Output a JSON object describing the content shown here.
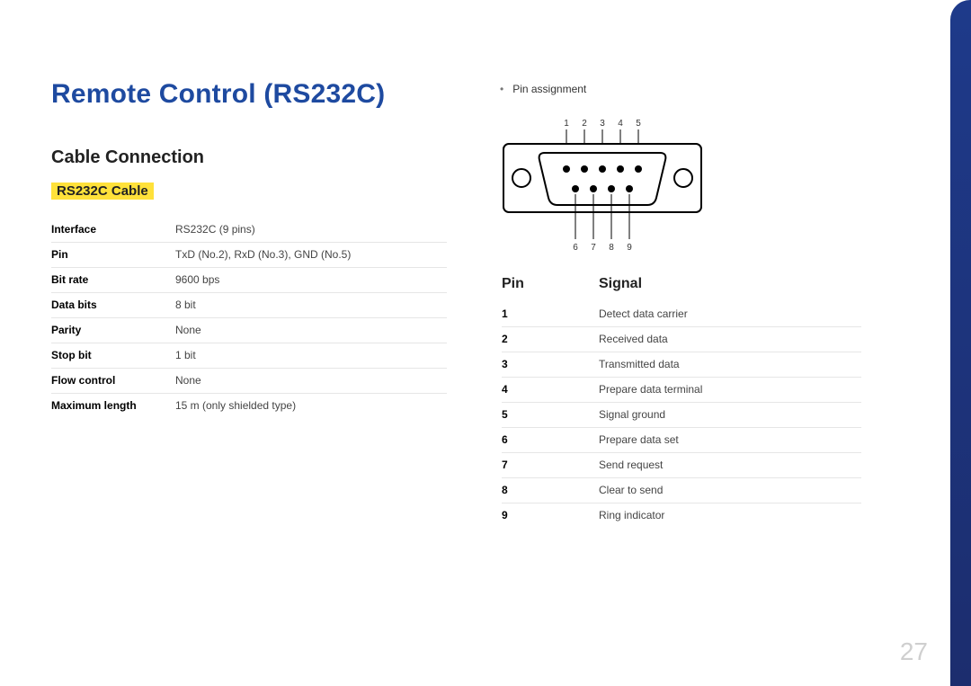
{
  "title": "Remote Control (RS232C)",
  "section": "Cable Connection",
  "subsection": "RS232C Cable",
  "page_number": "27",
  "cable_spec": [
    {
      "label": "Interface",
      "value": "RS232C (9 pins)"
    },
    {
      "label": "Pin",
      "value": "TxD (No.2), RxD (No.3), GND (No.5)"
    },
    {
      "label": "Bit rate",
      "value": "9600 bps"
    },
    {
      "label": "Data bits",
      "value": "8 bit"
    },
    {
      "label": "Parity",
      "value": "None"
    },
    {
      "label": "Stop bit",
      "value": "1 bit"
    },
    {
      "label": "Flow control",
      "value": "None"
    },
    {
      "label": "Maximum length",
      "value": "15 m (only shielded type)"
    }
  ],
  "diagram": {
    "bullet_label": "Pin assignment",
    "top_labels": [
      "1",
      "2",
      "3",
      "4",
      "5"
    ],
    "bottom_labels": [
      "6",
      "7",
      "8",
      "9"
    ]
  },
  "pin_table": {
    "header_pin": "Pin",
    "header_signal": "Signal",
    "rows": [
      {
        "pin": "1",
        "signal": "Detect data carrier"
      },
      {
        "pin": "2",
        "signal": "Received data"
      },
      {
        "pin": "3",
        "signal": "Transmitted data"
      },
      {
        "pin": "4",
        "signal": "Prepare data terminal"
      },
      {
        "pin": "5",
        "signal": "Signal ground"
      },
      {
        "pin": "6",
        "signal": "Prepare data set"
      },
      {
        "pin": "7",
        "signal": "Send request"
      },
      {
        "pin": "8",
        "signal": "Clear to send"
      },
      {
        "pin": "9",
        "signal": "Ring indicator"
      }
    ]
  }
}
